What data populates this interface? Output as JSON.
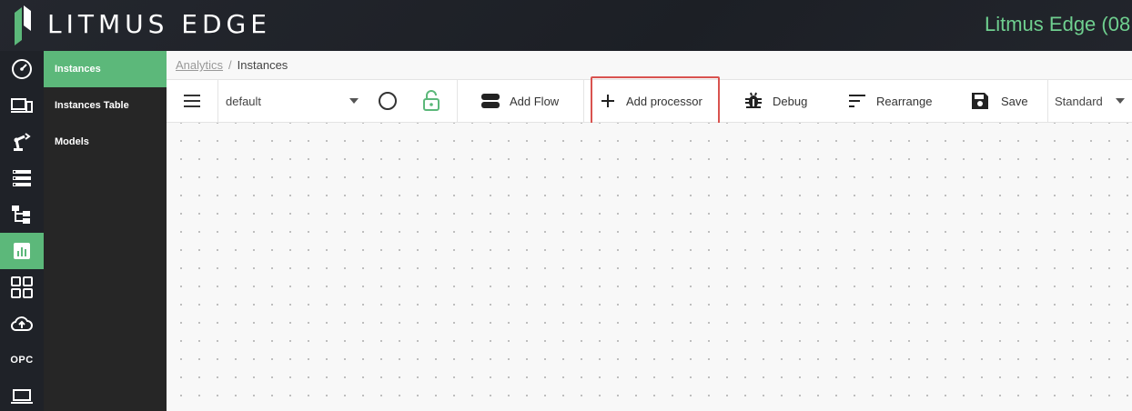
{
  "header": {
    "logo_text": "LITMUS EDGE",
    "right_text": "Litmus Edge (08"
  },
  "rail": {
    "items": [
      {
        "icon": "dashboard-gauge-icon"
      },
      {
        "icon": "devices-icon"
      },
      {
        "icon": "robot-arm-icon"
      },
      {
        "icon": "server-list-icon"
      },
      {
        "icon": "flow-hierarchy-icon"
      },
      {
        "icon": "analytics-chart-icon",
        "active": true
      },
      {
        "icon": "applications-grid-icon"
      },
      {
        "icon": "cloud-upload-icon"
      },
      {
        "label": "OPC"
      },
      {
        "icon": "laptop-icon"
      }
    ]
  },
  "subnav": {
    "items": [
      {
        "label": "Instances",
        "active": true
      },
      {
        "label": "Instances Table"
      },
      {
        "label": "Models"
      }
    ]
  },
  "breadcrumb": {
    "parent": "Analytics",
    "separator": "/",
    "current": "Instances"
  },
  "toolbar": {
    "flow_select_value": "default",
    "add_flow_label": "Add Flow",
    "add_processor_label": "Add processor",
    "debug_label": "Debug",
    "rearrange_label": "Rearrange",
    "save_label": "Save",
    "view_select_value": "Standard"
  },
  "colors": {
    "accent_green": "#5cb87a",
    "header_bg": "#1f2228",
    "highlight_red": "#d9534f"
  }
}
